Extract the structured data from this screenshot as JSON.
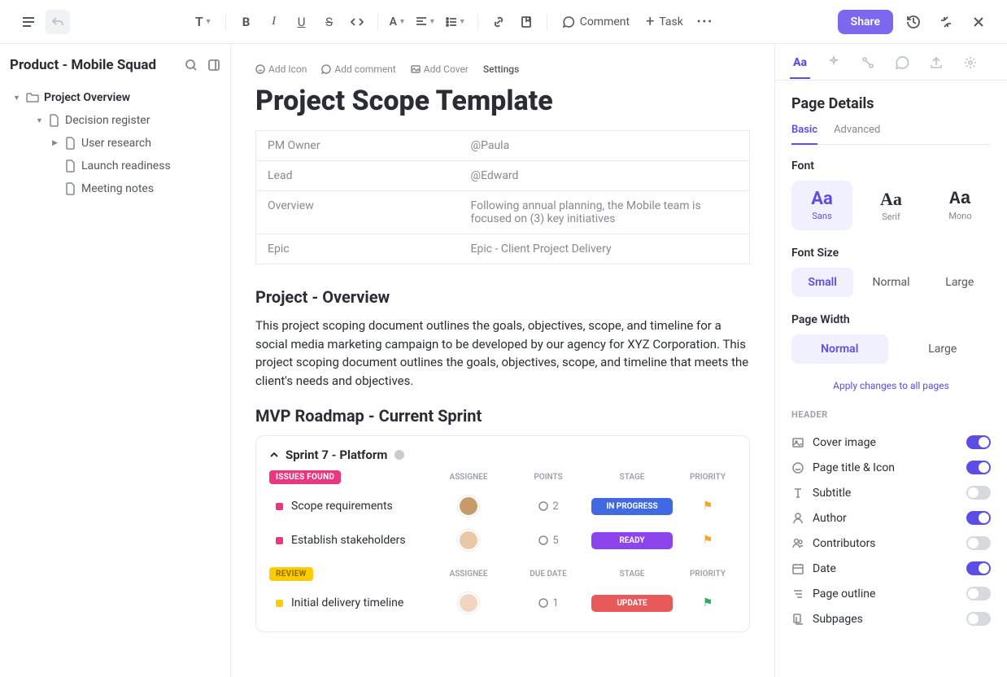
{
  "toolbar": {
    "text_style": "T",
    "comment": "Comment",
    "task": "Task",
    "share": "Share"
  },
  "sidebar": {
    "workspace": "Product - Mobile Squad",
    "items": [
      {
        "label": "Project Overview",
        "level": 1,
        "expanded": true,
        "icon": "folder"
      },
      {
        "label": "Decision register",
        "level": 2,
        "expanded": true,
        "icon": "doc"
      },
      {
        "label": "User research",
        "level": 3,
        "icon": "doc",
        "hasChildren": true
      },
      {
        "label": "Launch readiness",
        "level": 3,
        "icon": "doc"
      },
      {
        "label": "Meeting notes",
        "level": 3,
        "icon": "doc"
      }
    ]
  },
  "page": {
    "actions": {
      "add_icon": "Add Icon",
      "add_comment": "Add comment",
      "add_cover": "Add Cover",
      "settings": "Settings"
    },
    "title": "Project Scope Template",
    "properties": [
      {
        "label": "PM Owner",
        "value": "@Paula"
      },
      {
        "label": "Lead",
        "value": "@Edward"
      },
      {
        "label": "Overview",
        "value": "Following annual planning, the Mobile team is focused on (3) key initiatives"
      },
      {
        "label": "Epic",
        "value": "Epic - Client Project Delivery"
      }
    ],
    "sections": {
      "overview_heading": "Project - Overview",
      "overview_body": "This project scoping document outlines the goals, objectives, scope, and timeline for a social media marketing campaign to be developed by our agency for XYZ Corporation. This project scoping document outlines the goals, objectives, scope, and timeline that meets the client's needs and objectives.",
      "roadmap_heading": "MVP Roadmap - Current Sprint"
    },
    "sprint": {
      "name": "Sprint  7 - Platform",
      "groups": [
        {
          "badge": "ISSUES FOUND",
          "badge_style": "pink",
          "columns": [
            "ASSIGNEE",
            "POINTS",
            "STAGE",
            "PRIORITY"
          ],
          "tasks": [
            {
              "name": "Scope requirements",
              "points": "2",
              "stage": "IN PROGRESS",
              "stage_style": "blue",
              "flag": "orange"
            },
            {
              "name": "Establish stakeholders",
              "points": "5",
              "stage": "READY",
              "stage_style": "purple",
              "flag": "orange"
            }
          ]
        },
        {
          "badge": "REVIEW",
          "badge_style": "yellow",
          "columns": [
            "ASSIGNEE",
            "DUE DATE",
            "STAGE",
            "PRIORITY"
          ],
          "tasks": [
            {
              "name": "Initial delivery timeline",
              "points": "1",
              "stage": "UPDATE",
              "stage_style": "red",
              "flag": "green"
            }
          ]
        }
      ]
    }
  },
  "right_panel": {
    "title": "Page Details",
    "subtabs": {
      "basic": "Basic",
      "advanced": "Advanced"
    },
    "font": {
      "label": "Font",
      "sample": "Aa",
      "options": [
        "Sans",
        "Serif",
        "Mono"
      ],
      "active": "Sans"
    },
    "font_size": {
      "label": "Font Size",
      "options": [
        "Small",
        "Normal",
        "Large"
      ],
      "active": "Small"
    },
    "page_width": {
      "label": "Page Width",
      "options": [
        "Normal",
        "Large"
      ],
      "active": "Normal"
    },
    "apply_all": "Apply changes to all pages",
    "header_section": "HEADER",
    "toggles": [
      {
        "label": "Cover image",
        "on": true,
        "icon": "image"
      },
      {
        "label": "Page title & Icon",
        "on": true,
        "icon": "smile"
      },
      {
        "label": "Subtitle",
        "on": false,
        "icon": "text"
      },
      {
        "label": "Author",
        "on": true,
        "icon": "user"
      },
      {
        "label": "Contributors",
        "on": false,
        "icon": "users"
      },
      {
        "label": "Date",
        "on": true,
        "icon": "calendar"
      },
      {
        "label": "Page outline",
        "on": false,
        "icon": "outline"
      },
      {
        "label": "Subpages",
        "on": false,
        "icon": "subpages"
      }
    ]
  }
}
